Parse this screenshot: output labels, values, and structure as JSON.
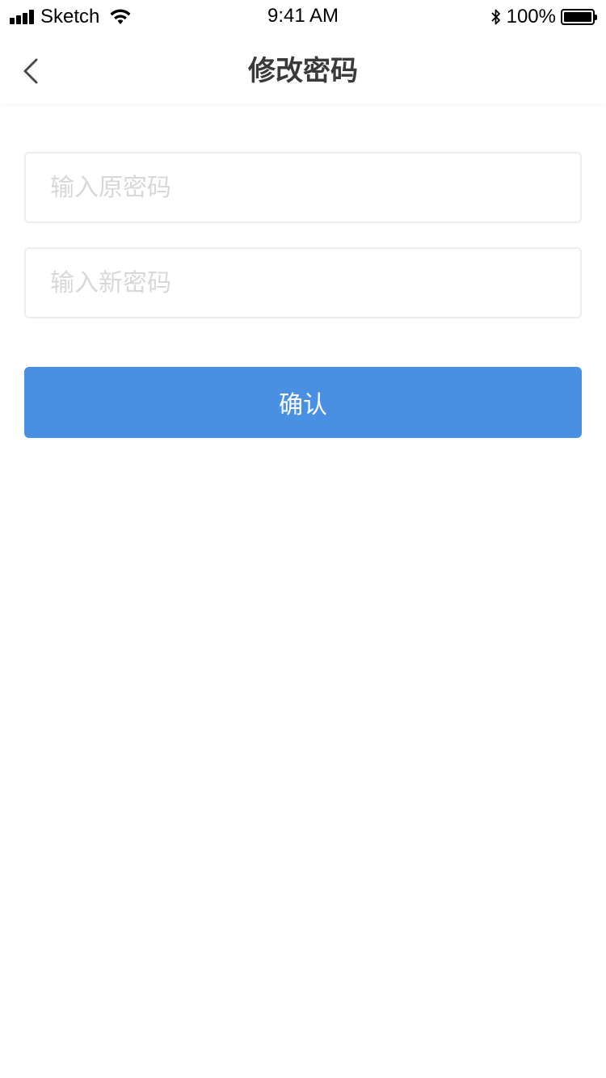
{
  "status_bar": {
    "carrier": "Sketch",
    "time": "9:41 AM",
    "battery_percent": "100%",
    "battery_level": 1.0,
    "signal_bars": 4,
    "icons": [
      "signal-icon",
      "wifi-icon",
      "bluetooth-icon",
      "battery-icon"
    ]
  },
  "nav": {
    "title": "修改密码",
    "back_icon": "chevron-left-icon"
  },
  "form": {
    "old_password": {
      "placeholder": "输入原密码",
      "value": ""
    },
    "new_password": {
      "placeholder": "输入新密码",
      "value": ""
    },
    "confirm_label": "确认"
  },
  "colors": {
    "primary": "#4a90e2",
    "title_text": "#3a3a3a",
    "placeholder": "#d8d8d8",
    "field_border": "#ededed"
  }
}
